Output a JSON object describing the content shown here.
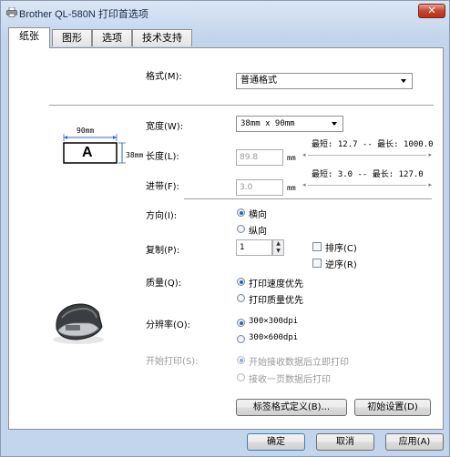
{
  "window": {
    "title": "Brother QL-580N 打印首选项",
    "close_label": "✕"
  },
  "tabs": [
    {
      "label": "纸张"
    },
    {
      "label": "图形"
    },
    {
      "label": "选项"
    },
    {
      "label": "技术支持"
    }
  ],
  "paper": {
    "format_label": "格式(M):",
    "format_value": "普通格式",
    "width_label": "宽度(W):",
    "width_value": "38mm x 90mm",
    "length_label": "长度(L):",
    "length_value": "89.8",
    "length_unit": "mm",
    "length_range": "最短: 12.7 -- 最长: 1000.0",
    "feed_label": "进带(F):",
    "feed_value": "3.0",
    "feed_unit": "mm",
    "feed_range": "最短: 3.0 -- 最长: 127.0",
    "preview": {
      "width_dim": "90mm",
      "height_dim": "38mm",
      "letter": "A"
    }
  },
  "orientation": {
    "label": "方向(I):",
    "options": [
      "横向",
      "纵向"
    ],
    "selected": "横向"
  },
  "copies": {
    "label": "复制(P):",
    "value": "1",
    "collate_label": "排序(C)",
    "reverse_label": "逆序(R)"
  },
  "quality": {
    "label": "质量(Q):",
    "options": [
      "打印速度优先",
      "打印质量优先"
    ],
    "selected": "打印速度优先"
  },
  "resolution": {
    "label": "分辨率(O):",
    "options": [
      "300×300dpi",
      "300×600dpi"
    ],
    "selected": "300×300dpi"
  },
  "start_print": {
    "label": "开始打印(S):",
    "options": [
      "开始接收数据后立即打印",
      "接收一页数据后打印"
    ],
    "selected": "开始接收数据后立即打印"
  },
  "panel_buttons": {
    "label_format": "标签格式定义(B)...",
    "defaults": "初始设置(D)"
  },
  "dialog_buttons": {
    "ok": "确定",
    "cancel": "取消",
    "apply": "应用(A)"
  }
}
